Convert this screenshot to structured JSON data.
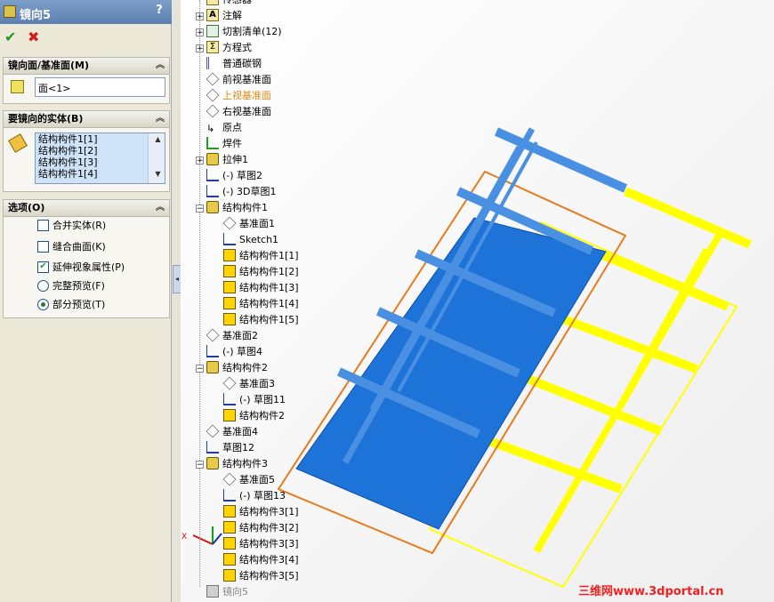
{
  "property_manager": {
    "title": "镜向5",
    "help": "?",
    "ok_icon": "check-icon",
    "cancel_icon": "x-icon",
    "mirror_face_group": {
      "header": "镜向面/基准面(M)",
      "value": "面<1>"
    },
    "bodies_group": {
      "header": "要镜向的实体(B)",
      "items": [
        "结构构件1[1]",
        "结构构件1[2]",
        "结构构件1[3]",
        "结构构件1[4]"
      ]
    },
    "options_group": {
      "header": "选项(O)",
      "merge_solids": {
        "label": "合并实体(R)",
        "checked": false
      },
      "knit_surfaces": {
        "label": "缝合曲面(K)",
        "checked": false
      },
      "propagate_visual": {
        "label": "延伸视象属性(P)",
        "checked": true
      },
      "full_preview": {
        "label": "完整预览(F)",
        "selected": false
      },
      "partial_preview": {
        "label": "部分预览(T)",
        "selected": true
      }
    }
  },
  "tree": [
    {
      "label": "传感器",
      "icon": "sensor-icon",
      "expander": false
    },
    {
      "label": "注解",
      "icon": "annotation-icon",
      "expander": true
    },
    {
      "label": "切割清单(12)",
      "icon": "cut-list-icon",
      "expander": true
    },
    {
      "label": "方程式",
      "icon": "equation-icon",
      "expander": true
    },
    {
      "label": "普通碳钢",
      "icon": "material-icon",
      "expander": false
    },
    {
      "label": "前视基准面",
      "icon": "plane-icon",
      "expander": false
    },
    {
      "label": "上视基准面",
      "icon": "plane-icon",
      "expander": false,
      "highlight": true
    },
    {
      "label": "右视基准面",
      "icon": "plane-icon",
      "expander": false
    },
    {
      "label": "原点",
      "icon": "origin-icon",
      "expander": false
    },
    {
      "label": "焊件",
      "icon": "weldment-icon",
      "expander": false
    },
    {
      "label": "拉伸1",
      "icon": "extrude-icon",
      "expander": true
    },
    {
      "label": "(-) 草图2",
      "icon": "sketch-icon",
      "expander": false
    },
    {
      "label": "(-) 3D草图1",
      "icon": "3dsketch-icon",
      "expander": false
    },
    {
      "label": "结构构件1",
      "icon": "structural-member-icon",
      "expander": true
    },
    {
      "label": "基准面1",
      "icon": "plane-icon",
      "expander": false,
      "indent": 1
    },
    {
      "label": "Sketch1",
      "icon": "sketch-icon",
      "expander": false,
      "indent": 1
    },
    {
      "label": "结构构件1[1]",
      "icon": "body-icon",
      "expander": false,
      "indent": 1
    },
    {
      "label": "结构构件1[2]",
      "icon": "body-icon",
      "expander": false,
      "indent": 1
    },
    {
      "label": "结构构件1[3]",
      "icon": "body-icon",
      "expander": false,
      "indent": 1
    },
    {
      "label": "结构构件1[4]",
      "icon": "body-icon",
      "expander": false,
      "indent": 1
    },
    {
      "label": "结构构件1[5]",
      "icon": "body-icon",
      "expander": false,
      "indent": 1
    },
    {
      "label": "基准面2",
      "icon": "plane-icon",
      "expander": false
    },
    {
      "label": "(-) 草图4",
      "icon": "sketch-icon",
      "expander": false
    },
    {
      "label": "结构构件2",
      "icon": "structural-member-icon",
      "expander": true
    },
    {
      "label": "基准面3",
      "icon": "plane-icon",
      "expander": false,
      "indent": 1
    },
    {
      "label": "(-) 草图11",
      "icon": "sketch-icon",
      "expander": false,
      "indent": 1
    },
    {
      "label": "结构构件2",
      "icon": "body-icon",
      "expander": false,
      "indent": 1
    },
    {
      "label": "基准面4",
      "icon": "plane-icon",
      "expander": false
    },
    {
      "label": "草图12",
      "icon": "sketch-icon",
      "expander": false
    },
    {
      "label": "结构构件3",
      "icon": "structural-member-icon",
      "expander": true
    },
    {
      "label": "基准面5",
      "icon": "plane-icon",
      "expander": false,
      "indent": 1
    },
    {
      "label": "(-) 草图13",
      "icon": "sketch-icon",
      "expander": false,
      "indent": 1
    },
    {
      "label": "结构构件3[1]",
      "icon": "body-icon",
      "expander": false,
      "indent": 1
    },
    {
      "label": "结构构件3[2]",
      "icon": "body-icon",
      "expander": false,
      "indent": 1
    },
    {
      "label": "结构构件3[3]",
      "icon": "body-icon",
      "expander": false,
      "indent": 1
    },
    {
      "label": "结构构件3[4]",
      "icon": "body-icon",
      "expander": false,
      "indent": 1
    },
    {
      "label": "结构构件3[5]",
      "icon": "body-icon",
      "expander": false,
      "indent": 1
    },
    {
      "label": "镜向5",
      "icon": "mirror-feature-icon",
      "expander": false,
      "dim": true
    }
  ],
  "triad": {
    "x_label": "X"
  },
  "watermark": "三维网www.3dportal.cn",
  "colors": {
    "title_bar": "#5c7fb3",
    "selected_blue": "#1e73d8",
    "frame_blue": "#4a90e2",
    "mirror_yellow": "#ffff00",
    "highlight_orange": "#e87a1c",
    "tree_highlight_text": "#e28a10"
  }
}
